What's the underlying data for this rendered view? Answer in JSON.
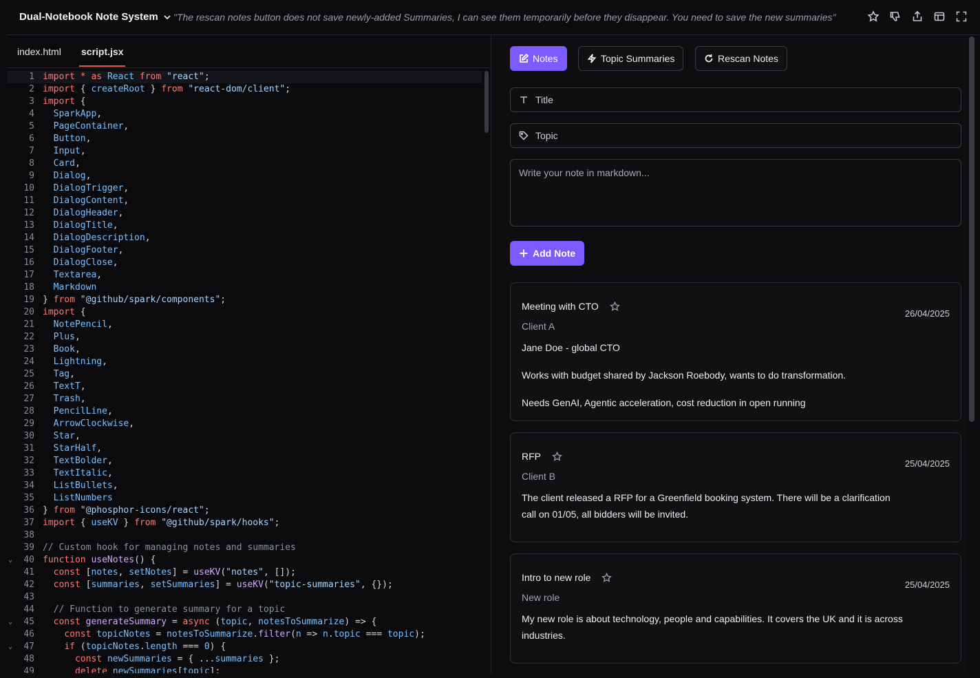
{
  "topbar": {
    "app_title": "Dual-Notebook Note System",
    "prompt": "\"The rescan notes button does not save newly-added Summaries, I can see them temporarily before they disappear. You need to save the new summaries\""
  },
  "editor": {
    "tabs": [
      {
        "label": "index.html",
        "active": false
      },
      {
        "label": "script.jsx",
        "active": true
      }
    ],
    "lines": [
      {
        "n": "1",
        "code": "<span class=\"kw\">import</span> <span class=\"kw\">*</span> <span class=\"kw\">as</span> <span class=\"id\">React</span> <span class=\"kw\">from</span> <span class=\"str\">\"react\"</span>;"
      },
      {
        "n": "2",
        "code": "<span class=\"kw\">import</span> { <span class=\"id\">createRoot</span> } <span class=\"kw\">from</span> <span class=\"str\">\"react-dom/client\"</span>;"
      },
      {
        "n": "3",
        "code": "<span class=\"kw\">import</span> {"
      },
      {
        "n": "4",
        "code": "  <span class=\"id\">SparkApp</span>,"
      },
      {
        "n": "5",
        "code": "  <span class=\"id\">PageContainer</span>,"
      },
      {
        "n": "6",
        "code": "  <span class=\"id\">Button</span>,"
      },
      {
        "n": "7",
        "code": "  <span class=\"id\">Input</span>,"
      },
      {
        "n": "8",
        "code": "  <span class=\"id\">Card</span>,"
      },
      {
        "n": "9",
        "code": "  <span class=\"id\">Dialog</span>,"
      },
      {
        "n": "10",
        "code": "  <span class=\"id\">DialogTrigger</span>,"
      },
      {
        "n": "11",
        "code": "  <span class=\"id\">DialogContent</span>,"
      },
      {
        "n": "12",
        "code": "  <span class=\"id\">DialogHeader</span>,"
      },
      {
        "n": "13",
        "code": "  <span class=\"id\">DialogTitle</span>,"
      },
      {
        "n": "14",
        "code": "  <span class=\"id\">DialogDescription</span>,"
      },
      {
        "n": "15",
        "code": "  <span class=\"id\">DialogFooter</span>,"
      },
      {
        "n": "16",
        "code": "  <span class=\"id\">DialogClose</span>,"
      },
      {
        "n": "17",
        "code": "  <span class=\"id\">Textarea</span>,"
      },
      {
        "n": "18",
        "code": "  <span class=\"id\">Markdown</span>"
      },
      {
        "n": "19",
        "code": "} <span class=\"kw\">from</span> <span class=\"str\">\"@github/spark/components\"</span>;"
      },
      {
        "n": "20",
        "code": "<span class=\"kw\">import</span> {"
      },
      {
        "n": "21",
        "code": "  <span class=\"id\">NotePencil</span>,"
      },
      {
        "n": "22",
        "code": "  <span class=\"id\">Plus</span>,"
      },
      {
        "n": "23",
        "code": "  <span class=\"id\">Book</span>,"
      },
      {
        "n": "24",
        "code": "  <span class=\"id\">Lightning</span>,"
      },
      {
        "n": "25",
        "code": "  <span class=\"id\">Tag</span>,"
      },
      {
        "n": "26",
        "code": "  <span class=\"id\">TextT</span>,"
      },
      {
        "n": "27",
        "code": "  <span class=\"id\">Trash</span>,"
      },
      {
        "n": "28",
        "code": "  <span class=\"id\">PencilLine</span>,"
      },
      {
        "n": "29",
        "code": "  <span class=\"id\">ArrowClockwise</span>,"
      },
      {
        "n": "30",
        "code": "  <span class=\"id\">Star</span>,"
      },
      {
        "n": "31",
        "code": "  <span class=\"id\">StarHalf</span>,"
      },
      {
        "n": "32",
        "code": "  <span class=\"id\">TextBolder</span>,"
      },
      {
        "n": "33",
        "code": "  <span class=\"id\">TextItalic</span>,"
      },
      {
        "n": "34",
        "code": "  <span class=\"id\">ListBullets</span>,"
      },
      {
        "n": "35",
        "code": "  <span class=\"id\">ListNumbers</span>"
      },
      {
        "n": "36",
        "code": "} <span class=\"kw\">from</span> <span class=\"str\">\"@phosphor-icons/react\"</span>;"
      },
      {
        "n": "37",
        "code": "<span class=\"kw\">import</span> { <span class=\"id\">useKV</span> } <span class=\"kw\">from</span> <span class=\"str\">\"@github/spark/hooks\"</span>;"
      },
      {
        "n": "38",
        "code": ""
      },
      {
        "n": "39",
        "code": "<span class=\"cm\">// Custom hook for managing notes and summaries</span>"
      },
      {
        "n": "40",
        "code": "<span class=\"kw\">function</span> <span class=\"fn\">useNotes</span>() {",
        "fold": true
      },
      {
        "n": "41",
        "code": "  <span class=\"kw\">const</span> [<span class=\"id\">notes</span>, <span class=\"id\">setNotes</span>] = <span class=\"fn\">useKV</span>(<span class=\"str\">\"notes\"</span>, []);"
      },
      {
        "n": "42",
        "code": "  <span class=\"kw\">const</span> [<span class=\"id\">summaries</span>, <span class=\"id\">setSummaries</span>] = <span class=\"fn\">useKV</span>(<span class=\"str\">\"topic-summaries\"</span>, {});"
      },
      {
        "n": "43",
        "code": ""
      },
      {
        "n": "44",
        "code": "  <span class=\"cm\">// Function to generate summary for a topic</span>"
      },
      {
        "n": "45",
        "code": "  <span class=\"kw\">const</span> <span class=\"fn\">generateSummary</span> = <span class=\"kw\">async</span> (<span class=\"id\">topic</span>, <span class=\"id\">notesToSummarize</span>) => {",
        "fold": true
      },
      {
        "n": "46",
        "code": "    <span class=\"kw\">const</span> <span class=\"id\">topicNotes</span> = <span class=\"id\">notesToSummarize</span>.<span class=\"fn\">filter</span>(<span class=\"id\">n</span> => <span class=\"id\">n</span>.<span class=\"id\">topic</span> === <span class=\"id\">topic</span>);"
      },
      {
        "n": "47",
        "code": "    <span class=\"kw\">if</span> (<span class=\"id\">topicNotes</span>.<span class=\"id\">length</span> === <span class=\"id\">0</span>) {",
        "fold": true
      },
      {
        "n": "48",
        "code": "      <span class=\"kw\">const</span> <span class=\"id\">newSummaries</span> = { ...<span class=\"id\">summaries</span> };"
      },
      {
        "n": "49",
        "code": "      <span class=\"kw\">delete</span> <span class=\"id\">newSummaries</span>[<span class=\"id\">topic</span>];"
      }
    ]
  },
  "preview": {
    "tabs": [
      {
        "label": "Notes",
        "icon": "note-pencil-icon",
        "active": true
      },
      {
        "label": "Topic Summaries",
        "icon": "lightning-icon",
        "active": false
      },
      {
        "label": "Rescan Notes",
        "icon": "arrow-clockwise-icon",
        "active": false
      }
    ],
    "title_placeholder": "Title",
    "topic_placeholder": "Topic",
    "note_placeholder": "Write your note in markdown...",
    "add_note_label": "Add Note",
    "notes": [
      {
        "title": "Meeting with CTO",
        "topic": "Client A",
        "date": "26/04/2025",
        "body": [
          "Jane Doe - global CTO",
          "Works with budget shared by Jackson Roebody, wants to do transformation.",
          "Needs GenAI, Agentic acceleration, cost reduction in open running"
        ]
      },
      {
        "title": "RFP",
        "topic": "Client B",
        "date": "25/04/2025",
        "body": [
          "The client released a RFP for a Greenfield booking system. There will be a clarification call on 01/05, all bidders will be invited."
        ]
      },
      {
        "title": "Intro to new role",
        "topic": "New role",
        "date": "25/04/2025",
        "body": [
          "My new role is about technology, people and capabilities. It covers the UK and it is across industries."
        ]
      }
    ]
  },
  "colors": {
    "accent": "#7c5cff",
    "active_tab_underline": "#e2574c"
  }
}
